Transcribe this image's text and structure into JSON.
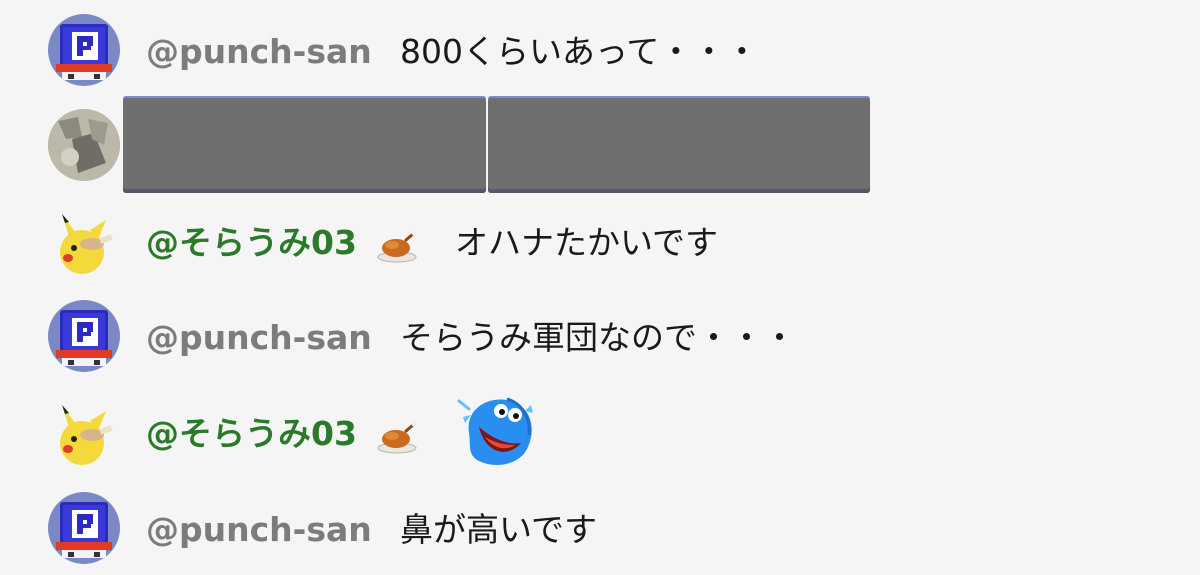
{
  "messages": [
    {
      "id": "m1",
      "user": "@punch-san",
      "text": "800くらいあって・・・"
    },
    {
      "id": "m2",
      "user": "",
      "text": ""
    },
    {
      "id": "m3",
      "user": "@そらうみ03",
      "text": "オハナたかいです"
    },
    {
      "id": "m4",
      "user": "@punch-san",
      "text": "そらうみ軍団なので・・・"
    },
    {
      "id": "m5",
      "user": "@そらうみ03",
      "text": ""
    },
    {
      "id": "m6",
      "user": "@punch-san",
      "text": "鼻が高いです"
    }
  ],
  "icons": {
    "punch_avatar": "pixel-robot-avatar-icon",
    "photo_avatar": "photo-avatar-icon",
    "soraumi_avatar": "pikachu-avatar-icon",
    "badge": "roast-chicken-badge-icon",
    "sticker": "laughing-blue-blob-sticker-icon"
  },
  "colors": {
    "background": "#f5f5f5",
    "username_gray": "#7c7c7c",
    "username_green": "#2a7a2a",
    "message_text": "#1a1a1a",
    "redacted_block": "#6f6f70"
  }
}
